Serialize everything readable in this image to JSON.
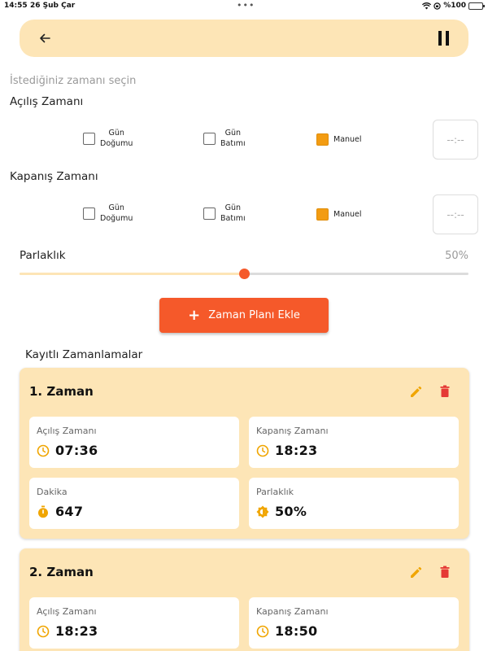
{
  "status": {
    "time": "14:55",
    "date": "26 Şub Çar",
    "battery": "%100"
  },
  "page": {
    "hint": "İstediğiniz zamanı seçin",
    "open_label": "Açılış Zamanı",
    "close_label": "Kapanış Zamanı"
  },
  "opening": {
    "sunrise_l1": "Gün",
    "sunrise_l2": "Doğumu",
    "sunset_l1": "Gün",
    "sunset_l2": "Batımı",
    "manual": "Manuel",
    "selected": "manual",
    "time_placeholder": "--:--"
  },
  "closing": {
    "sunrise_l1": "Gün",
    "sunrise_l2": "Doğumu",
    "sunset_l1": "Gün",
    "sunset_l2": "Batımı",
    "manual": "Manuel",
    "selected": "manual",
    "time_placeholder": "--:--"
  },
  "brightness": {
    "label": "Parlaklık",
    "value_text": "50%",
    "value": 0.5
  },
  "add_button": {
    "label": "Zaman Planı Ekle"
  },
  "saved": {
    "title": "Kayıtlı Zamanlamalar",
    "schedules": [
      {
        "title": "1. Zaman",
        "open_label": "Açılış Zamanı",
        "open": "07:36",
        "close_label": "Kapanış Zamanı",
        "close": "18:23",
        "minutes_label": "Dakika",
        "minutes": "647",
        "bright_label": "Parlaklık",
        "bright": "50%"
      },
      {
        "title": "2. Zaman",
        "open_label": "Açılış Zamanı",
        "open": "18:23",
        "close_label": "Kapanış Zamanı",
        "close": "18:50"
      }
    ]
  },
  "colors": {
    "accent": "#f5592a",
    "card": "#fde5b6",
    "checkbox": "#f39c12",
    "icon": "#f0a500",
    "delete": "#e53935"
  },
  "icons": [
    "back-arrow-icon",
    "pause-icon",
    "edit-icon",
    "delete-icon",
    "clock-icon",
    "timer-icon",
    "brightness-icon"
  ]
}
